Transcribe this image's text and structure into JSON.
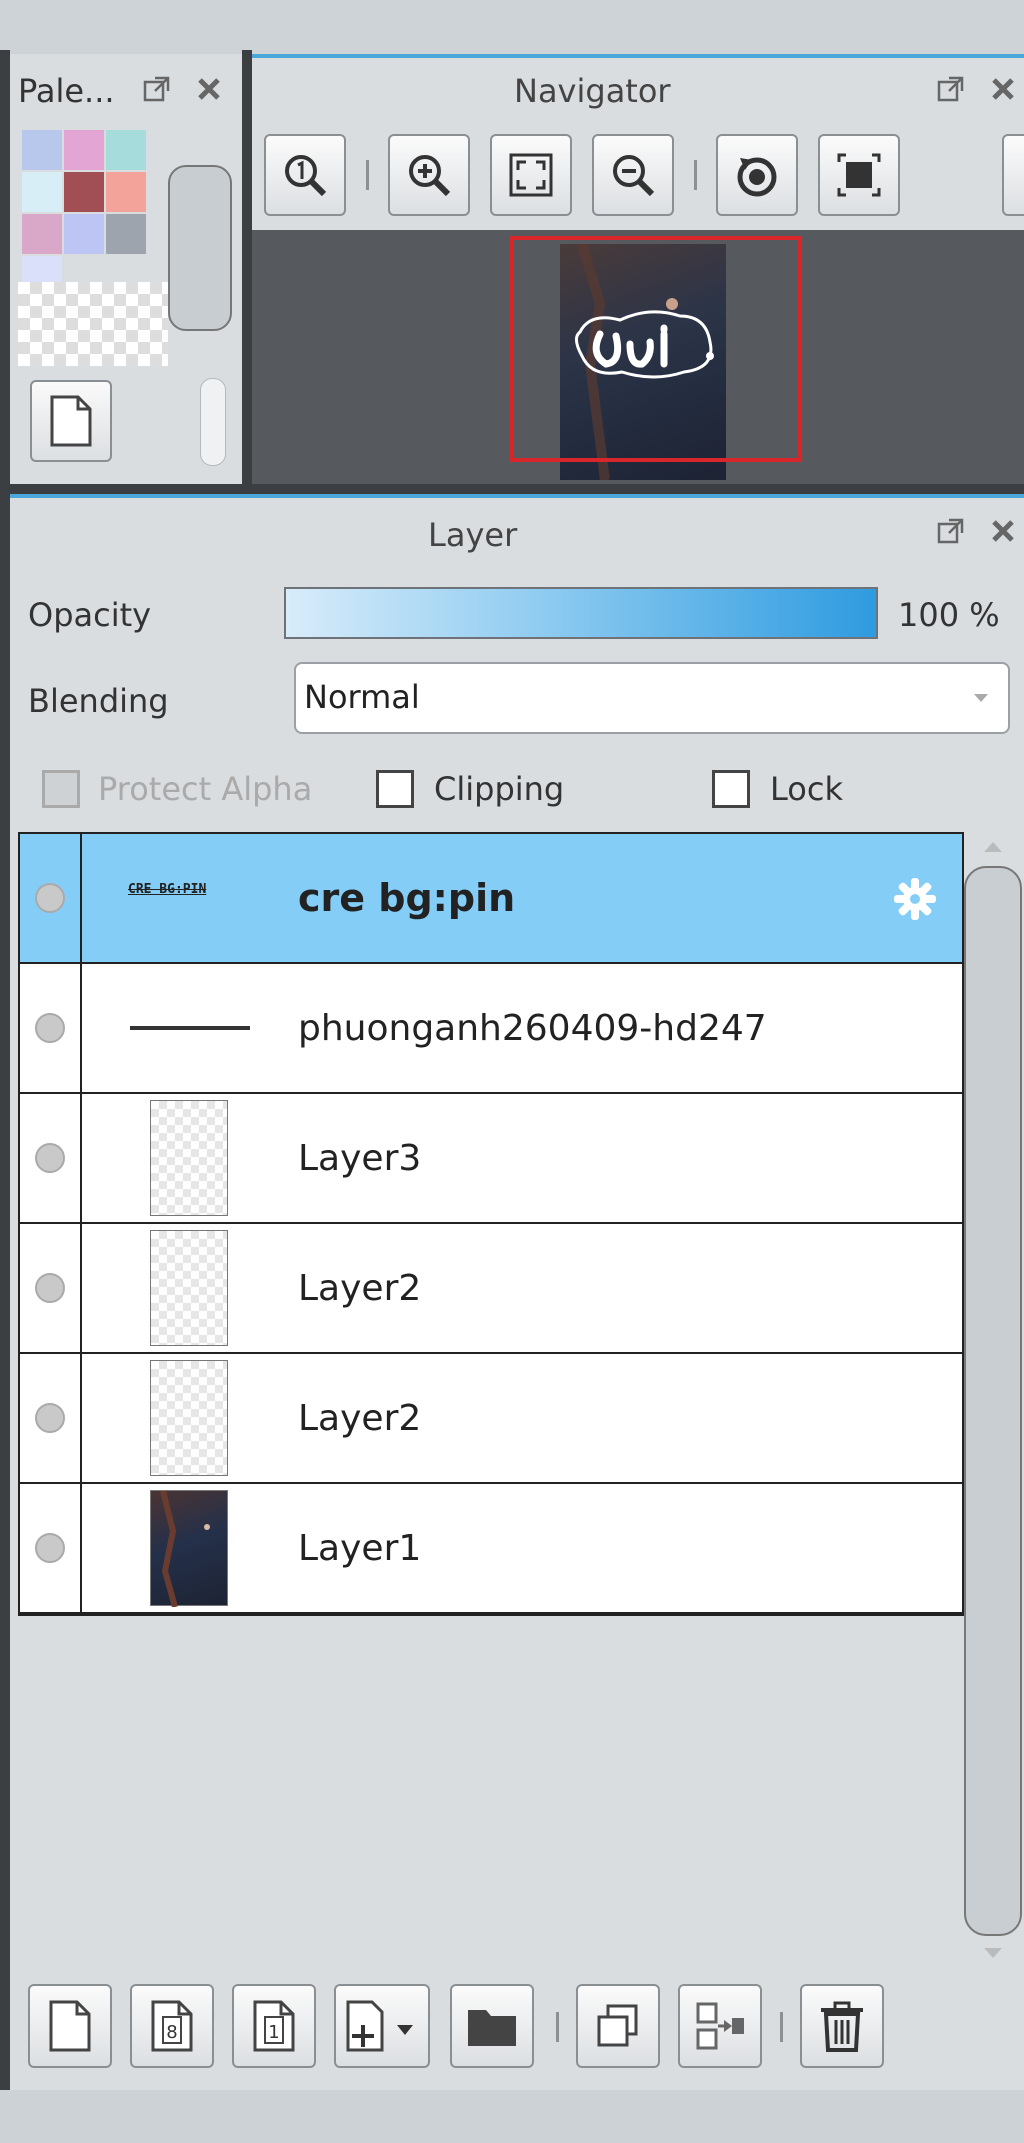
{
  "palette": {
    "title": "Pale...",
    "swatches": [
      "#b8c8ec",
      "#e3a5d3",
      "#a7dcdc",
      "#d7eef6",
      "#a14f55",
      "#f3a39a",
      "#d9a8c8",
      "#bcc5f4",
      "#9da4ad",
      "#dae0fa"
    ],
    "new_icon": "new-page-icon"
  },
  "navigator": {
    "title": "Navigator",
    "tools": [
      "zoom-actual-icon",
      "zoom-in-icon",
      "fit-window-icon",
      "zoom-out-icon",
      "rotate-icon",
      "fit-canvas-icon"
    ]
  },
  "layer": {
    "title": "Layer",
    "opacity_label": "Opacity",
    "opacity_value": "100 %",
    "opacity_fraction": 1.0,
    "blending_label": "Blending",
    "blending_value": "Normal",
    "protect_alpha_label": "Protect Alpha",
    "clipping_label": "Clipping",
    "lock_label": "Lock",
    "rows": [
      {
        "name": "cre bg:pin",
        "thumb_text": "CRE BG:PIN",
        "selected": true
      },
      {
        "name": "phuonganh260409-hd247",
        "selected": false
      },
      {
        "name": "Layer3",
        "selected": false
      },
      {
        "name": "Layer2",
        "selected": false
      },
      {
        "name": "Layer2",
        "selected": false
      },
      {
        "name": "Layer1",
        "selected": false
      }
    ],
    "bottom_tools": [
      "new-layer-icon",
      "new-8bit-layer-icon",
      "new-1bit-layer-icon",
      "add-layer-menu-icon",
      "new-folder-icon",
      "duplicate-layer-icon",
      "merge-down-icon",
      "delete-layer-icon"
    ]
  },
  "colors": {
    "accent": "#4aa7d9",
    "selection": "#83cdf6",
    "navigator_frame": "#d9262a"
  }
}
